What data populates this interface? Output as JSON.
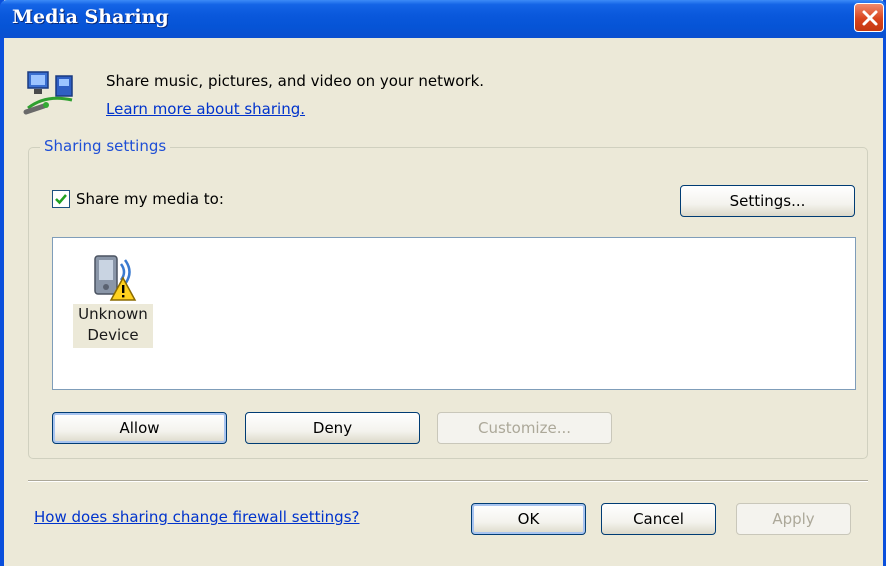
{
  "window": {
    "title": "Media Sharing"
  },
  "intro": {
    "text": "Share music, pictures, and video on your network.",
    "learn_link": "Learn more about sharing.",
    "icon": "network-media-icon"
  },
  "sharing_settings": {
    "legend": "Sharing settings",
    "share_checkbox": {
      "label": "Share my media to:",
      "checked": true
    },
    "settings_button": "Settings...",
    "devices": [
      {
        "name_line1": "Unknown",
        "name_line2": "Device",
        "icon": "device-warning-icon"
      }
    ],
    "allow_button": "Allow",
    "deny_button": "Deny",
    "customize_button": "Customize..."
  },
  "footer": {
    "firewall_link": "How does sharing change firewall settings?",
    "ok_button": "OK",
    "cancel_button": "Cancel",
    "apply_button": "Apply"
  },
  "colors": {
    "titlebar": "#0a58dc",
    "window_bg": "#ece9d8",
    "link": "#0033cc",
    "legend": "#1f4fd6",
    "close_button": "#d9441d"
  }
}
